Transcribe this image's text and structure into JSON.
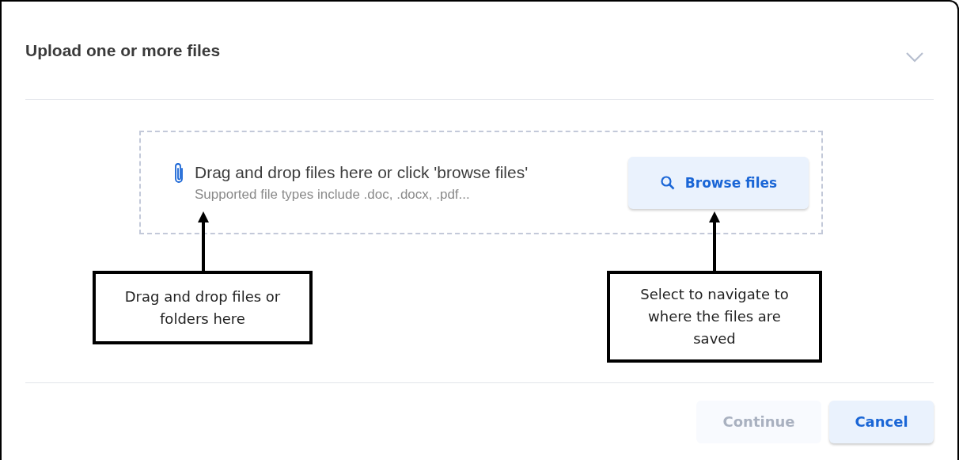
{
  "dialog": {
    "title": "Upload one or more files"
  },
  "dropzone": {
    "instruction": "Drag and drop files here or click 'browse files'",
    "hint": "Supported file types include .doc, .docx, .pdf...",
    "browse_button": "Browse files"
  },
  "annotations": [
    {
      "text": "Drag and drop files or folders here",
      "kind": "dropzone"
    },
    {
      "text": "Select to navigate to where the files are saved",
      "kind": "browse"
    }
  ],
  "buttons": [
    {
      "label": "Continue",
      "disabled": true
    },
    {
      "label": "Cancel",
      "disabled": false
    }
  ]
}
